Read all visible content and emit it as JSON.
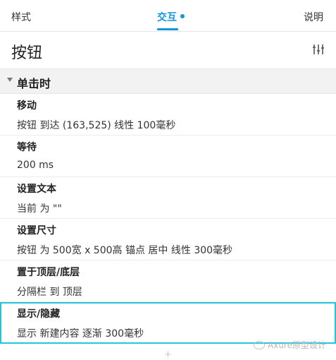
{
  "tabs": [
    {
      "label": "样式"
    },
    {
      "label": "交互"
    },
    {
      "label": "说明"
    }
  ],
  "widget": {
    "title": "按钮"
  },
  "event": {
    "title": "单击时"
  },
  "actions": [
    {
      "name": "移动",
      "detail": "按钮 到达 (163,525) 线性 100毫秒"
    },
    {
      "name": "等待",
      "detail": "200 ms"
    },
    {
      "name": "设置文本",
      "detail": "当前 为 \"\""
    },
    {
      "name": "设置尺寸",
      "detail": "按钮 为 500宽 x 500高  锚点 居中 线性 300毫秒"
    },
    {
      "name": "置于顶层/底层",
      "detail": "分隔栏 到 顶层"
    },
    {
      "name": "显示/隐藏",
      "detail": "显示 新建内容 逐渐 300毫秒"
    }
  ],
  "watermark": {
    "text": "Axure原型设计"
  },
  "colors": {
    "accent": "#1296db",
    "selection": "#22c7d9"
  }
}
